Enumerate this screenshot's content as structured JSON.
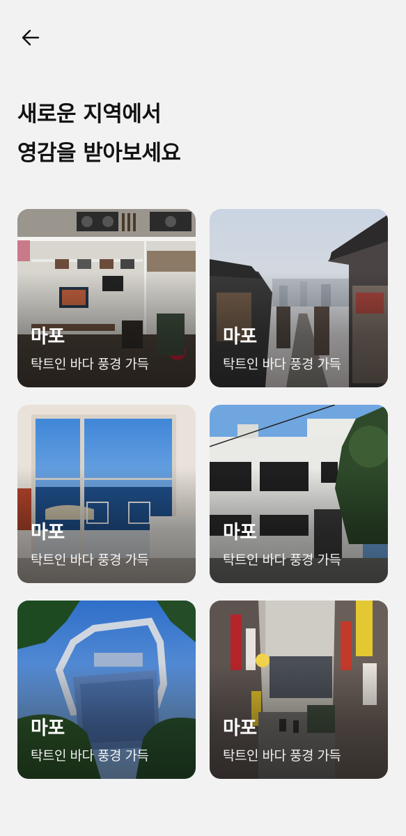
{
  "header": {
    "back_icon": "arrow-left-icon",
    "title_line1": "새로운 지역에서",
    "title_line2": "영감을 받아보세요"
  },
  "cards": [
    {
      "title": "마포",
      "subtitle": "탁트인 바다 풍경 가득",
      "scene": "cafe-interior-photo"
    },
    {
      "title": "마포",
      "subtitle": "탁트인 바다 풍경 가득",
      "scene": "hanok-village-alley-photo"
    },
    {
      "title": "마포",
      "subtitle": "탁트인 바다 풍경 가득",
      "scene": "ocean-view-window-photo"
    },
    {
      "title": "마포",
      "subtitle": "탁트인 바다 풍경 가득",
      "scene": "white-building-street-photo"
    },
    {
      "title": "마포",
      "subtitle": "탁트인 바다 풍경 가득",
      "scene": "ring-tower-building-photo"
    },
    {
      "title": "마포",
      "subtitle": "탁트인 바다 풍경 가득",
      "scene": "neon-sign-street-photo"
    }
  ],
  "colors": {
    "background": "#f2f2f2",
    "text": "#111111",
    "overlay_text": "#ffffff"
  }
}
